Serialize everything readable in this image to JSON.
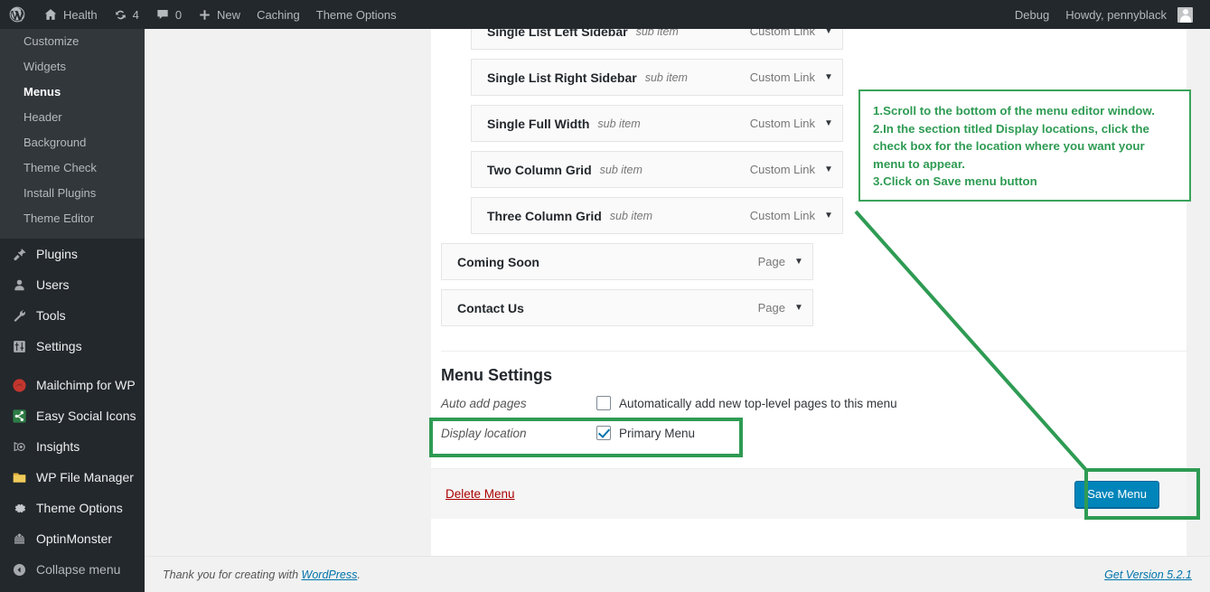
{
  "adminbar": {
    "site_name": "Health",
    "updates_count": "4",
    "comments_count": "0",
    "new_label": "New",
    "caching_label": "Caching",
    "theme_options_label": "Theme Options",
    "debug_label": "Debug",
    "howdy_label": "Howdy, pennyblack"
  },
  "sidebar": {
    "submenu": [
      {
        "label": "Customize",
        "current": false
      },
      {
        "label": "Widgets",
        "current": false
      },
      {
        "label": "Menus",
        "current": true
      },
      {
        "label": "Header",
        "current": false
      },
      {
        "label": "Background",
        "current": false
      },
      {
        "label": "Theme Check",
        "current": false
      },
      {
        "label": "Install Plugins",
        "current": false
      },
      {
        "label": "Theme Editor",
        "current": false
      }
    ],
    "items": [
      {
        "label": "Plugins",
        "icon": "plug-icon"
      },
      {
        "label": "Users",
        "icon": "user-icon"
      },
      {
        "label": "Tools",
        "icon": "wrench-icon"
      },
      {
        "label": "Settings",
        "icon": "sliders-icon"
      },
      {
        "label": "Mailchimp for WP",
        "icon": "mailchimp-icon"
      },
      {
        "label": "Easy Social Icons",
        "icon": "share-icon"
      },
      {
        "label": "Insights",
        "icon": "insights-icon"
      },
      {
        "label": "WP File Manager",
        "icon": "folder-icon"
      },
      {
        "label": "Theme Options",
        "icon": "gear-icon"
      },
      {
        "label": "OptinMonster",
        "icon": "optinmonster-icon"
      },
      {
        "label": "Collapse menu",
        "icon": "collapse-icon"
      }
    ]
  },
  "menu_rows": [
    {
      "title": "Single List Left Sidebar",
      "sub": "sub item",
      "type": "Custom Link",
      "indent": true
    },
    {
      "title": "Single List Right Sidebar",
      "sub": "sub item",
      "type": "Custom Link",
      "indent": true
    },
    {
      "title": "Single Full Width",
      "sub": "sub item",
      "type": "Custom Link",
      "indent": true
    },
    {
      "title": "Two Column Grid",
      "sub": "sub item",
      "type": "Custom Link",
      "indent": true
    },
    {
      "title": "Three Column Grid",
      "sub": "sub item",
      "type": "Custom Link",
      "indent": true
    },
    {
      "title": "Coming Soon",
      "sub": "",
      "type": "Page",
      "indent": false
    },
    {
      "title": "Contact Us",
      "sub": "",
      "type": "Page",
      "indent": false
    }
  ],
  "menu_settings": {
    "heading": "Menu Settings",
    "auto_add_label": "Auto add pages",
    "auto_add_checkbox_label": "Automatically add new top-level pages to this menu",
    "auto_add_checked": false,
    "display_location_label": "Display location",
    "display_location_checkbox_label": "Primary Menu",
    "display_location_checked": true
  },
  "actions": {
    "delete_label": "Delete Menu",
    "save_label": "Save Menu"
  },
  "annotation": {
    "lines": [
      "1.Scroll to the bottom of the menu editor window.",
      "2.In the section titled Display locations, click the",
      "check box for the location where you want your",
      "menu to appear.",
      "3.Click on Save menu button"
    ],
    "color": "#2e9b53"
  },
  "footer": {
    "thanks_prefix": "Thank you for creating with ",
    "wordpress_link": "WordPress",
    "thanks_suffix": ".",
    "version": "Get Version 5.2.1"
  },
  "colors": {
    "admin_bar": "#23282d",
    "sidebar": "#23282d",
    "submenu": "#32373c",
    "accent_blue": "#0085ba",
    "delete_red": "#a00",
    "annotation_green": "#2e9b53"
  }
}
